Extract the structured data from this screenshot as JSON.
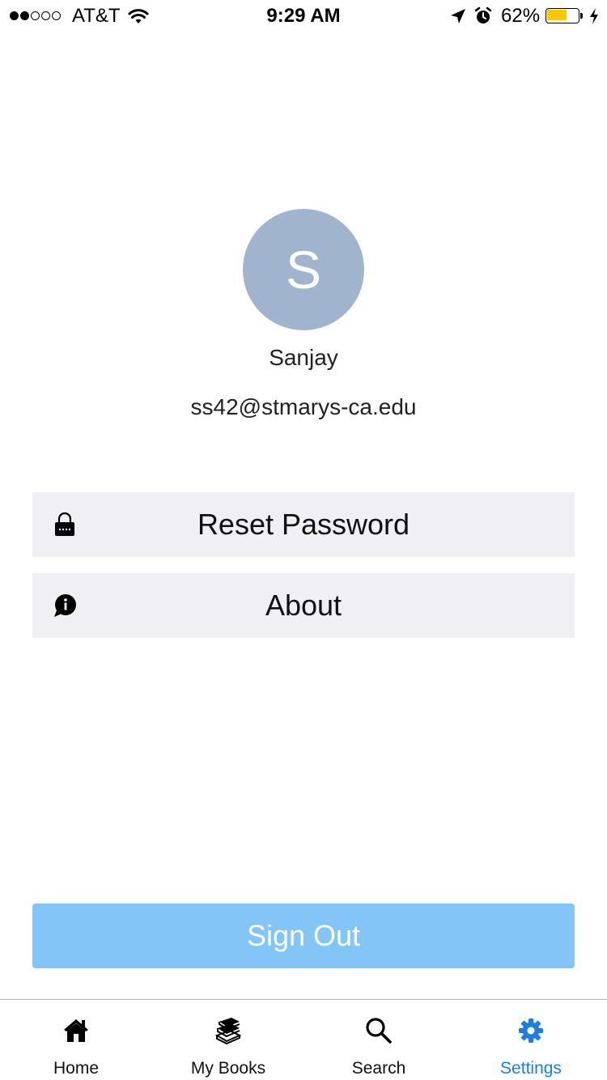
{
  "status_bar": {
    "carrier": "AT&T",
    "signal": {
      "filled": 2,
      "total": 5
    },
    "time": "9:29 AM",
    "battery_percent": "62%",
    "battery_level": 0.62,
    "battery_color": "#f9c802",
    "icons": [
      "wifi-icon",
      "location-arrow-icon",
      "alarm-icon",
      "battery-icon",
      "charging-bolt-icon"
    ]
  },
  "profile": {
    "avatar_initial": "S",
    "avatar_color": "#a0b4cd",
    "name": "Sanjay",
    "email": "ss42@stmarys-ca.edu"
  },
  "menu": {
    "items": [
      {
        "label": "Reset Password",
        "icon": "lock-icon"
      },
      {
        "label": "About",
        "icon": "info-bubble-icon"
      }
    ]
  },
  "sign_out": {
    "label": "Sign Out",
    "color": "#83c5f7"
  },
  "tab_bar": {
    "active_color": "#1b7ee8",
    "tabs": [
      {
        "label": "Home",
        "icon": "home-icon",
        "active": false
      },
      {
        "label": "My Books",
        "icon": "books-icon",
        "active": false
      },
      {
        "label": "Search",
        "icon": "search-icon",
        "active": false
      },
      {
        "label": "Settings",
        "icon": "gear-icon",
        "active": true
      }
    ]
  }
}
